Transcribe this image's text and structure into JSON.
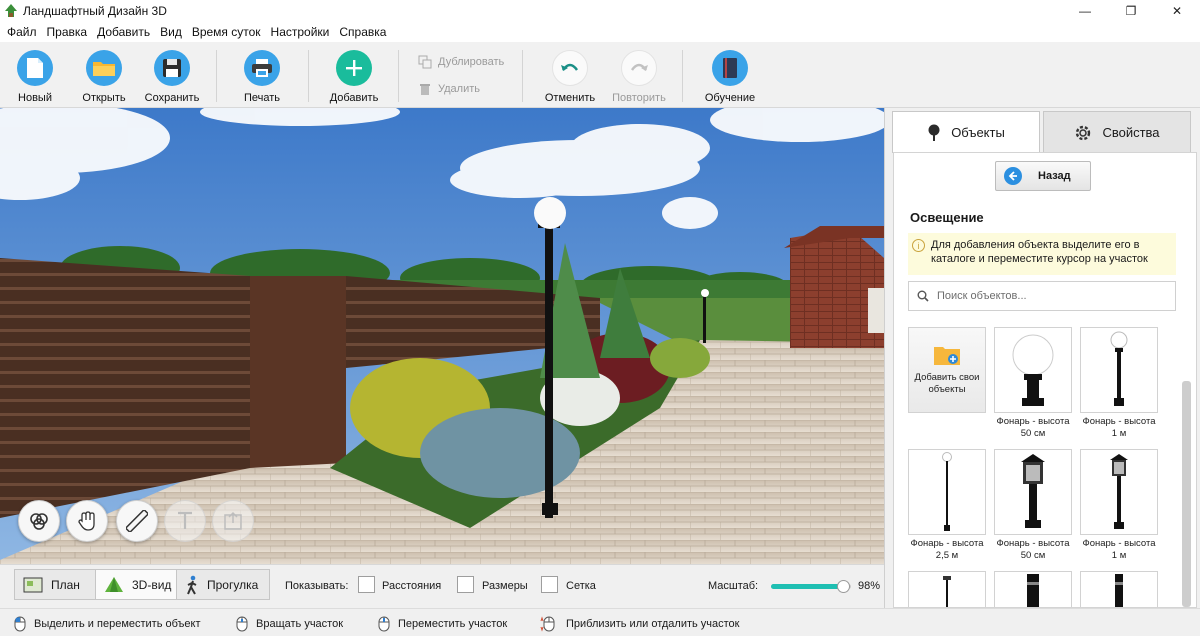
{
  "window": {
    "title": "Ландшафтный Дизайн 3D",
    "minimize": "—",
    "maximize": "❐",
    "close": "✕"
  },
  "menu": [
    "Файл",
    "Правка",
    "Добавить",
    "Вид",
    "Время суток",
    "Настройки",
    "Справка"
  ],
  "toolbar": {
    "new": "Новый",
    "open": "Открыть",
    "save": "Сохранить",
    "print": "Печать",
    "add": "Добавить",
    "duplicate": "Дублировать",
    "delete": "Удалить",
    "undo": "Отменить",
    "redo": "Повторить",
    "learn": "Обучение"
  },
  "view_tabs": {
    "plan": "План",
    "view3d": "3D-вид",
    "walk": "Прогулка"
  },
  "show": {
    "label": "Показывать:",
    "options": [
      {
        "label": "Расстояния",
        "checked": false
      },
      {
        "label": "Размеры",
        "checked": false
      },
      {
        "label": "Сетка",
        "checked": false
      }
    ]
  },
  "zoom": {
    "label": "Масштаб:",
    "value_text": "98%",
    "fraction": 0.9
  },
  "status": [
    "Выделить и переместить объект",
    "Вращать участок",
    "Переместить участок",
    "Приблизить или отдалить участок"
  ],
  "right_panel": {
    "tabs": {
      "objects": "Объекты",
      "properties": "Свойства"
    },
    "back": "Назад",
    "section": "Освещение",
    "hint": "Для добавления объекта выделите его в каталоге и переместите курсор на участок",
    "hint_icon": "i",
    "search_placeholder": "Поиск объектов...",
    "catalog": [
      {
        "caption": "Добавить свои объекты"
      },
      {
        "caption": "Фонарь - высота 50 см"
      },
      {
        "caption": "Фонарь - высота 1 м"
      },
      {
        "caption": "Фонарь - высота 2,5 м"
      },
      {
        "caption": "Фонарь - высота 50 см"
      },
      {
        "caption": "Фонарь - высота 1 м"
      }
    ]
  },
  "colors": {
    "accent": "#1fbfb2",
    "add_button": "#1abc9c",
    "hint_bg": "#fdfbdc"
  }
}
